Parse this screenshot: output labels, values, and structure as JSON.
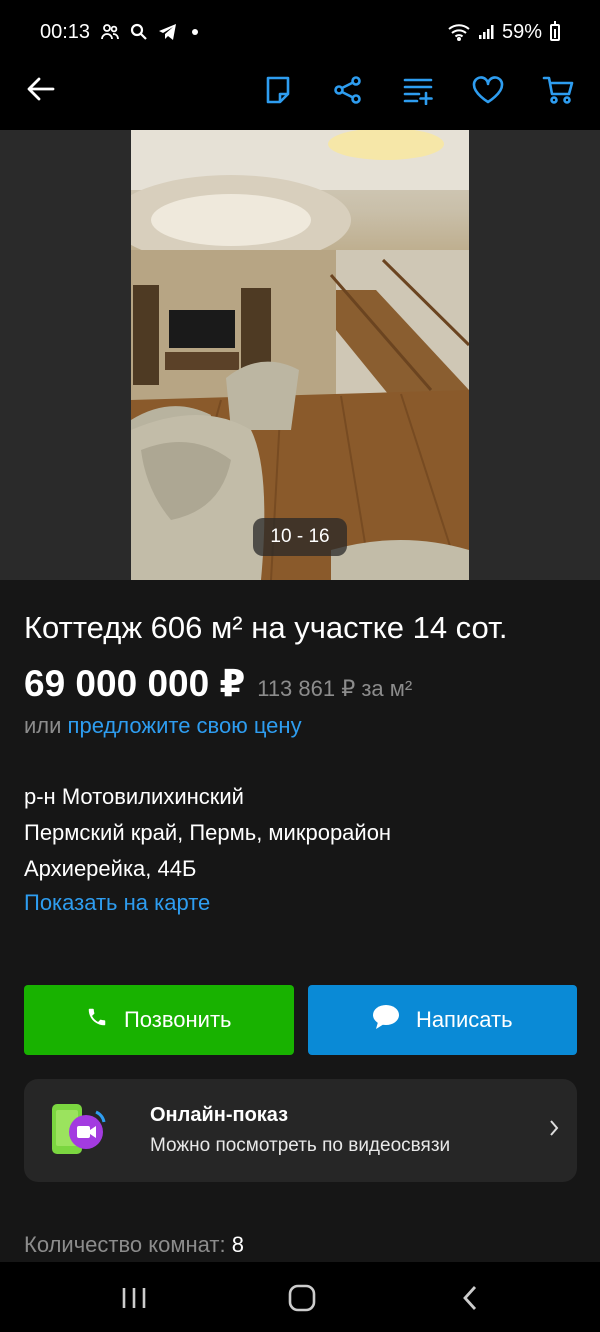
{
  "status_bar": {
    "time": "00:13",
    "battery": "59%"
  },
  "toolbar": {
    "icons": [
      "back-arrow-icon",
      "note-icon",
      "share-icon",
      "compare-list-icon",
      "favorite-heart-icon",
      "cart-icon"
    ]
  },
  "gallery": {
    "counter": "10 - 16"
  },
  "listing": {
    "title": "Коттедж 606 м² на участке 14 сот.",
    "price": "69 000 000 ₽",
    "price_per_m2": "113 861 ₽ за м²",
    "offer_prefix": "или",
    "offer_link": "предложите свою цену",
    "district": "р-н Мотовилихинский",
    "address": "Пермский край, Пермь, микрорайон Архиерейка, 44Б",
    "map_link": "Показать на карте"
  },
  "actions": {
    "call_label": "Позвонить",
    "write_label": "Написать"
  },
  "online_show": {
    "title": "Онлайн-показ",
    "subtitle": "Можно посмотреть по видеосвязи"
  },
  "params": {
    "rooms_label": "Количество комнат:",
    "rooms_value": "8"
  },
  "colors": {
    "accent_blue": "#2e9df0",
    "call_green": "#18b200",
    "write_blue": "#0a8ad6",
    "background": "#161616"
  }
}
